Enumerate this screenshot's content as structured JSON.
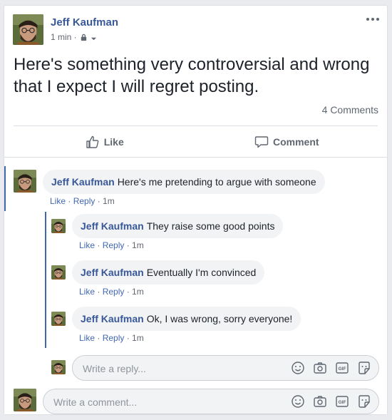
{
  "post": {
    "author": "Jeff Kaufman",
    "time": "1 min ·",
    "text": "Here's something very controversial and wrong that I expect I will regret posting.",
    "comment_count": "4 Comments",
    "like_label": "Like",
    "comment_label": "Comment"
  },
  "comments": [
    {
      "name": "Jeff Kaufman",
      "text": "Here's me pretending to argue with someone",
      "like": "Like",
      "reply": "Reply",
      "time": "1m",
      "replies": [
        {
          "name": "Jeff Kaufman",
          "text": "They raise some good points",
          "like": "Like",
          "reply": "Reply",
          "time": "1m"
        },
        {
          "name": "Jeff Kaufman",
          "text": "Eventually I'm convinced",
          "like": "Like",
          "reply": "Reply",
          "time": "1m"
        },
        {
          "name": "Jeff Kaufman",
          "text": "Ok, I was wrong, sorry everyone!",
          "like": "Like",
          "reply": "Reply",
          "time": "1m"
        }
      ]
    }
  ],
  "reply_input": {
    "placeholder": "Write a reply..."
  },
  "comment_input": {
    "placeholder": "Write a comment..."
  },
  "icons": [
    "more-options-icon",
    "lock-icon",
    "caret-down-icon",
    "like-icon",
    "comment-icon",
    "emoji-icon",
    "camera-icon",
    "gif-icon",
    "sticker-icon"
  ],
  "colors": {
    "name_blue": "#385898",
    "link_blue": "#4267b2",
    "bubble_bg": "#f2f3f5"
  }
}
